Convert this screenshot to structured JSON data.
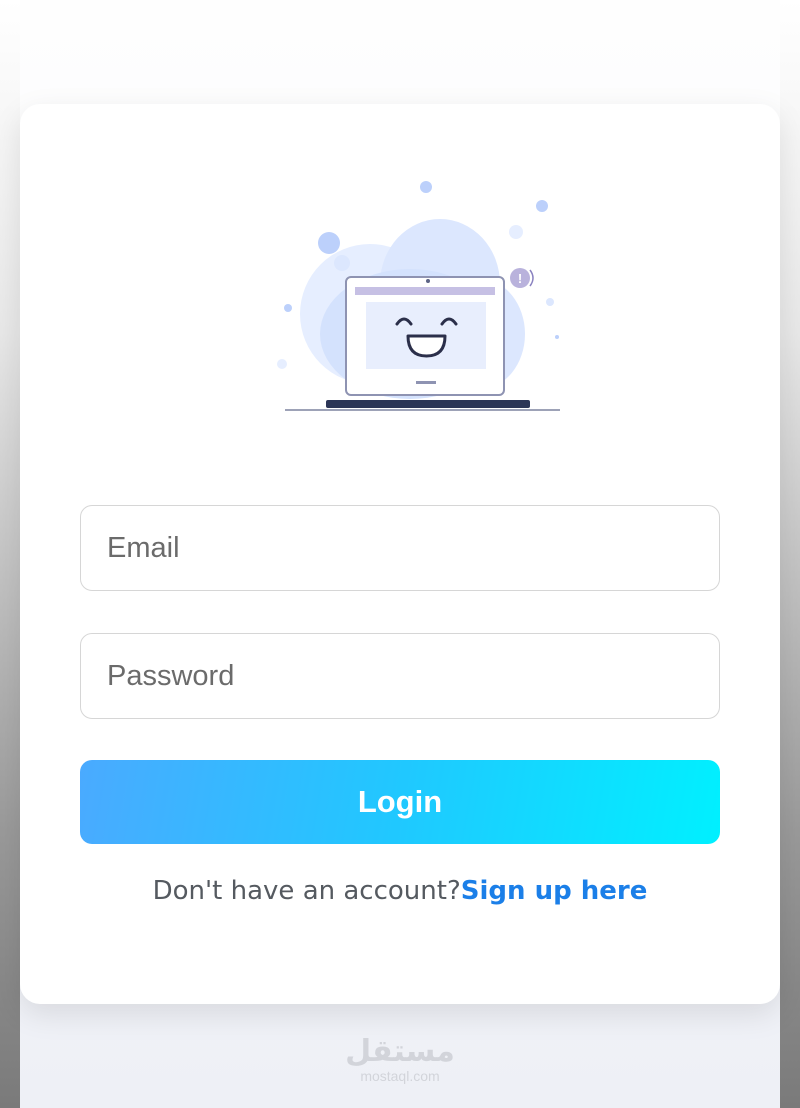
{
  "form": {
    "email_placeholder": "Email",
    "password_placeholder": "Password",
    "login_label": "Login"
  },
  "signup": {
    "prompt": "Don't have an account?",
    "link_label": "Sign up here"
  },
  "watermark": {
    "arabic": "مستقل",
    "latin": "mostaql.com"
  },
  "colors": {
    "button_gradient_start": "#4aaaff",
    "button_gradient_end": "#00f0ff",
    "link": "#1b7fe8",
    "illustration_accent": "#bcd0fb"
  },
  "illustration": {
    "icon": "happy-laptop-icon"
  }
}
